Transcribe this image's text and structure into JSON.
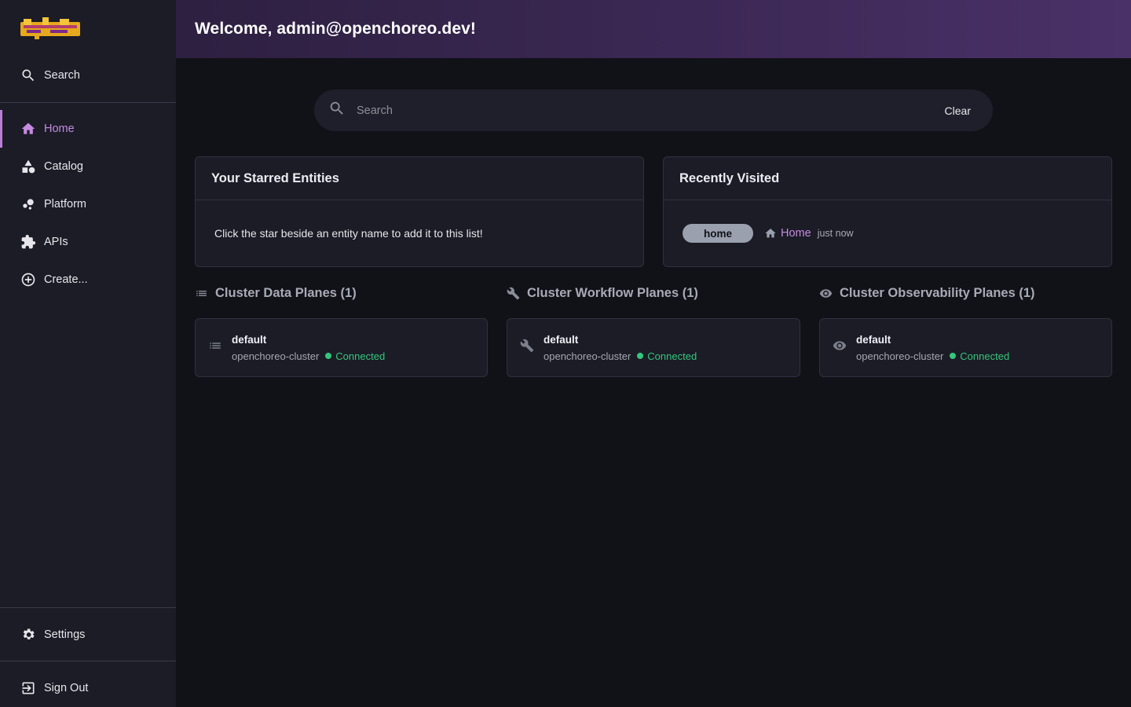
{
  "header": {
    "title": "Welcome, admin@openchoreo.dev!"
  },
  "sidebar": {
    "search_label": "Search",
    "items": [
      {
        "label": "Home"
      },
      {
        "label": "Catalog"
      },
      {
        "label": "Platform"
      },
      {
        "label": "APIs"
      },
      {
        "label": "Create..."
      }
    ],
    "settings_label": "Settings",
    "signout_label": "Sign Out"
  },
  "search": {
    "placeholder": "Search",
    "clear_label": "Clear"
  },
  "starred": {
    "title": "Your Starred Entities",
    "empty_text": "Click the star beside an entity name to add it to this list!"
  },
  "recent": {
    "title": "Recently Visited",
    "chip": "home",
    "link": "Home",
    "time": "just now"
  },
  "clusters": [
    {
      "title": "Cluster Data Planes (1)",
      "name": "default",
      "cluster": "openchoreo-cluster",
      "status": "Connected"
    },
    {
      "title": "Cluster Workflow Planes (1)",
      "name": "default",
      "cluster": "openchoreo-cluster",
      "status": "Connected"
    },
    {
      "title": "Cluster Observability Planes (1)",
      "name": "default",
      "cluster": "openchoreo-cluster",
      "status": "Connected"
    }
  ],
  "colors": {
    "accent": "#c58be0",
    "connected": "#34c77b"
  }
}
